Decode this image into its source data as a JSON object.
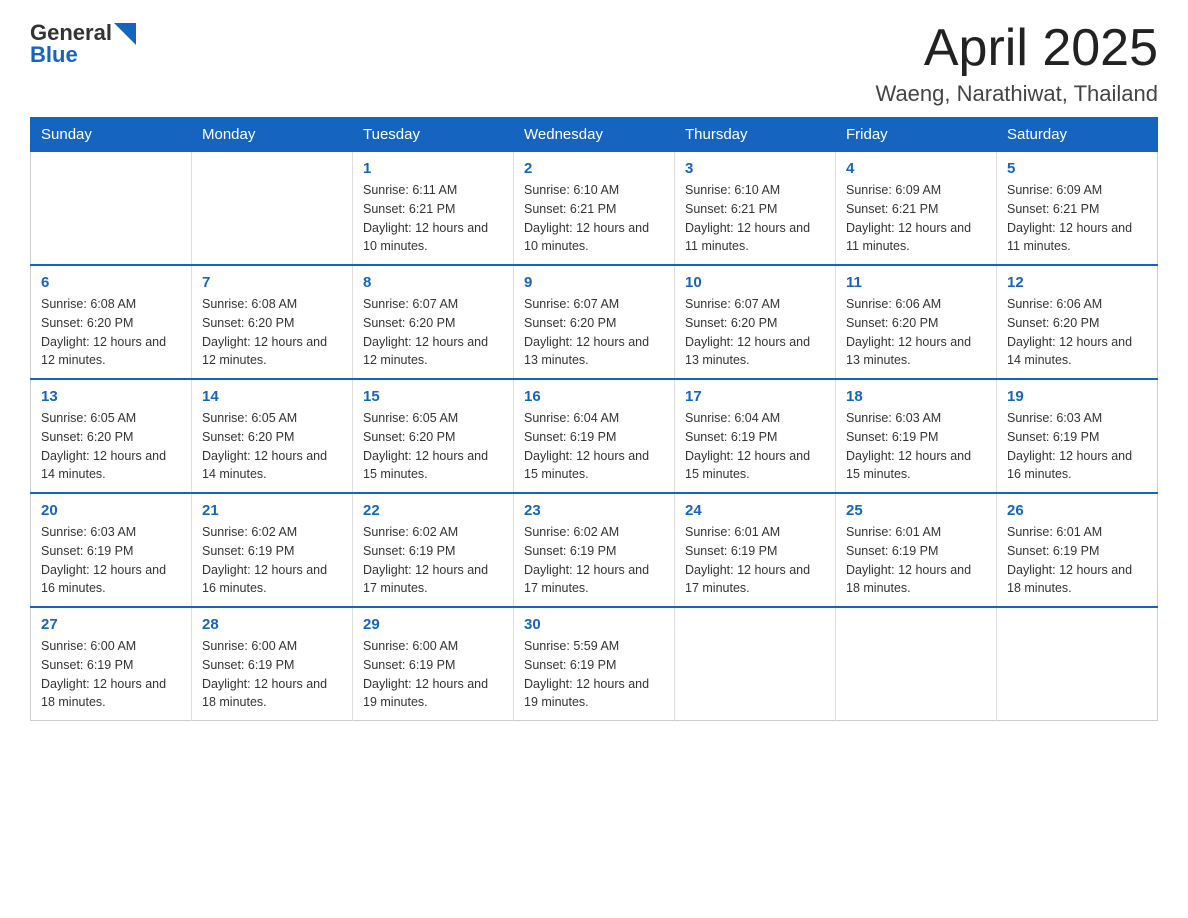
{
  "header": {
    "logo_general": "General",
    "logo_blue": "Blue",
    "month_title": "April 2025",
    "location": "Waeng, Narathiwat, Thailand"
  },
  "weekdays": [
    "Sunday",
    "Monday",
    "Tuesday",
    "Wednesday",
    "Thursday",
    "Friday",
    "Saturday"
  ],
  "weeks": [
    [
      {
        "day": "",
        "sunrise": "",
        "sunset": "",
        "daylight": ""
      },
      {
        "day": "",
        "sunrise": "",
        "sunset": "",
        "daylight": ""
      },
      {
        "day": "1",
        "sunrise": "Sunrise: 6:11 AM",
        "sunset": "Sunset: 6:21 PM",
        "daylight": "Daylight: 12 hours and 10 minutes."
      },
      {
        "day": "2",
        "sunrise": "Sunrise: 6:10 AM",
        "sunset": "Sunset: 6:21 PM",
        "daylight": "Daylight: 12 hours and 10 minutes."
      },
      {
        "day": "3",
        "sunrise": "Sunrise: 6:10 AM",
        "sunset": "Sunset: 6:21 PM",
        "daylight": "Daylight: 12 hours and 11 minutes."
      },
      {
        "day": "4",
        "sunrise": "Sunrise: 6:09 AM",
        "sunset": "Sunset: 6:21 PM",
        "daylight": "Daylight: 12 hours and 11 minutes."
      },
      {
        "day": "5",
        "sunrise": "Sunrise: 6:09 AM",
        "sunset": "Sunset: 6:21 PM",
        "daylight": "Daylight: 12 hours and 11 minutes."
      }
    ],
    [
      {
        "day": "6",
        "sunrise": "Sunrise: 6:08 AM",
        "sunset": "Sunset: 6:20 PM",
        "daylight": "Daylight: 12 hours and 12 minutes."
      },
      {
        "day": "7",
        "sunrise": "Sunrise: 6:08 AM",
        "sunset": "Sunset: 6:20 PM",
        "daylight": "Daylight: 12 hours and 12 minutes."
      },
      {
        "day": "8",
        "sunrise": "Sunrise: 6:07 AM",
        "sunset": "Sunset: 6:20 PM",
        "daylight": "Daylight: 12 hours and 12 minutes."
      },
      {
        "day": "9",
        "sunrise": "Sunrise: 6:07 AM",
        "sunset": "Sunset: 6:20 PM",
        "daylight": "Daylight: 12 hours and 13 minutes."
      },
      {
        "day": "10",
        "sunrise": "Sunrise: 6:07 AM",
        "sunset": "Sunset: 6:20 PM",
        "daylight": "Daylight: 12 hours and 13 minutes."
      },
      {
        "day": "11",
        "sunrise": "Sunrise: 6:06 AM",
        "sunset": "Sunset: 6:20 PM",
        "daylight": "Daylight: 12 hours and 13 minutes."
      },
      {
        "day": "12",
        "sunrise": "Sunrise: 6:06 AM",
        "sunset": "Sunset: 6:20 PM",
        "daylight": "Daylight: 12 hours and 14 minutes."
      }
    ],
    [
      {
        "day": "13",
        "sunrise": "Sunrise: 6:05 AM",
        "sunset": "Sunset: 6:20 PM",
        "daylight": "Daylight: 12 hours and 14 minutes."
      },
      {
        "day": "14",
        "sunrise": "Sunrise: 6:05 AM",
        "sunset": "Sunset: 6:20 PM",
        "daylight": "Daylight: 12 hours and 14 minutes."
      },
      {
        "day": "15",
        "sunrise": "Sunrise: 6:05 AM",
        "sunset": "Sunset: 6:20 PM",
        "daylight": "Daylight: 12 hours and 15 minutes."
      },
      {
        "day": "16",
        "sunrise": "Sunrise: 6:04 AM",
        "sunset": "Sunset: 6:19 PM",
        "daylight": "Daylight: 12 hours and 15 minutes."
      },
      {
        "day": "17",
        "sunrise": "Sunrise: 6:04 AM",
        "sunset": "Sunset: 6:19 PM",
        "daylight": "Daylight: 12 hours and 15 minutes."
      },
      {
        "day": "18",
        "sunrise": "Sunrise: 6:03 AM",
        "sunset": "Sunset: 6:19 PM",
        "daylight": "Daylight: 12 hours and 15 minutes."
      },
      {
        "day": "19",
        "sunrise": "Sunrise: 6:03 AM",
        "sunset": "Sunset: 6:19 PM",
        "daylight": "Daylight: 12 hours and 16 minutes."
      }
    ],
    [
      {
        "day": "20",
        "sunrise": "Sunrise: 6:03 AM",
        "sunset": "Sunset: 6:19 PM",
        "daylight": "Daylight: 12 hours and 16 minutes."
      },
      {
        "day": "21",
        "sunrise": "Sunrise: 6:02 AM",
        "sunset": "Sunset: 6:19 PM",
        "daylight": "Daylight: 12 hours and 16 minutes."
      },
      {
        "day": "22",
        "sunrise": "Sunrise: 6:02 AM",
        "sunset": "Sunset: 6:19 PM",
        "daylight": "Daylight: 12 hours and 17 minutes."
      },
      {
        "day": "23",
        "sunrise": "Sunrise: 6:02 AM",
        "sunset": "Sunset: 6:19 PM",
        "daylight": "Daylight: 12 hours and 17 minutes."
      },
      {
        "day": "24",
        "sunrise": "Sunrise: 6:01 AM",
        "sunset": "Sunset: 6:19 PM",
        "daylight": "Daylight: 12 hours and 17 minutes."
      },
      {
        "day": "25",
        "sunrise": "Sunrise: 6:01 AM",
        "sunset": "Sunset: 6:19 PM",
        "daylight": "Daylight: 12 hours and 18 minutes."
      },
      {
        "day": "26",
        "sunrise": "Sunrise: 6:01 AM",
        "sunset": "Sunset: 6:19 PM",
        "daylight": "Daylight: 12 hours and 18 minutes."
      }
    ],
    [
      {
        "day": "27",
        "sunrise": "Sunrise: 6:00 AM",
        "sunset": "Sunset: 6:19 PM",
        "daylight": "Daylight: 12 hours and 18 minutes."
      },
      {
        "day": "28",
        "sunrise": "Sunrise: 6:00 AM",
        "sunset": "Sunset: 6:19 PM",
        "daylight": "Daylight: 12 hours and 18 minutes."
      },
      {
        "day": "29",
        "sunrise": "Sunrise: 6:00 AM",
        "sunset": "Sunset: 6:19 PM",
        "daylight": "Daylight: 12 hours and 19 minutes."
      },
      {
        "day": "30",
        "sunrise": "Sunrise: 5:59 AM",
        "sunset": "Sunset: 6:19 PM",
        "daylight": "Daylight: 12 hours and 19 minutes."
      },
      {
        "day": "",
        "sunrise": "",
        "sunset": "",
        "daylight": ""
      },
      {
        "day": "",
        "sunrise": "",
        "sunset": "",
        "daylight": ""
      },
      {
        "day": "",
        "sunrise": "",
        "sunset": "",
        "daylight": ""
      }
    ]
  ]
}
